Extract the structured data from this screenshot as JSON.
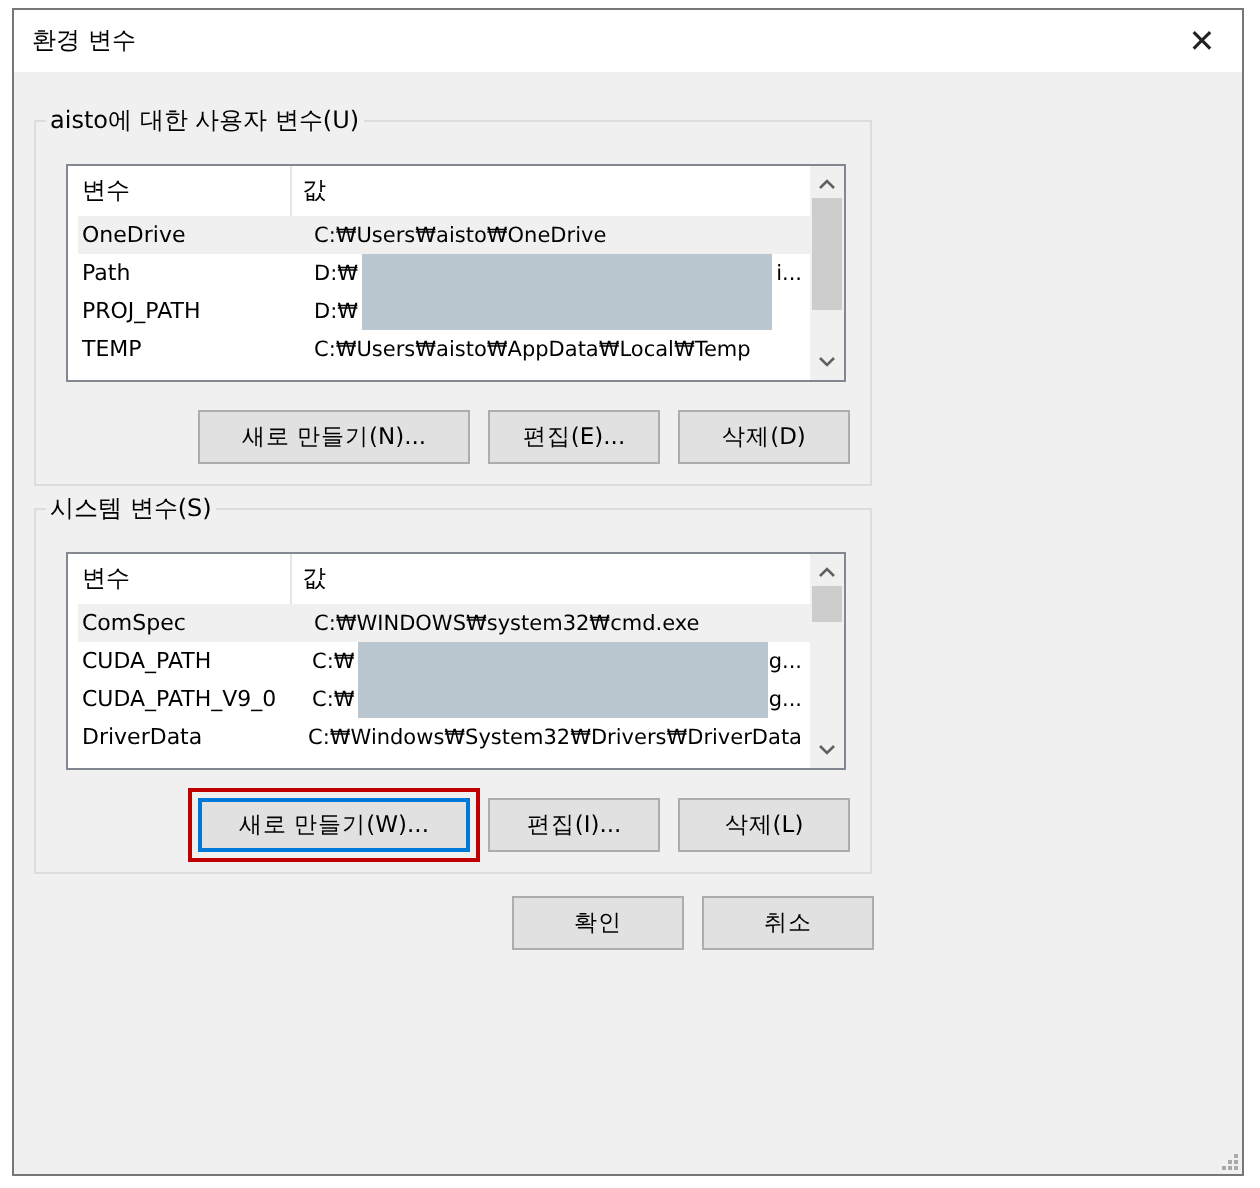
{
  "window": {
    "title": "환경 변수",
    "close": "✕"
  },
  "groups": [
    {
      "title": "aisto에 대한 사용자 변수(U)",
      "columns": [
        "변수",
        "값"
      ],
      "rows": [
        {
          "name": "OneDrive",
          "value": "C:₩Users₩aisto₩OneDrive",
          "selected": true
        },
        {
          "name": "Path",
          "value": "D:₩",
          "value_end": "i...",
          "redacted": true,
          "selected": false
        },
        {
          "name": "PROJ_PATH",
          "value": "D:₩",
          "redacted": true,
          "selected": false
        },
        {
          "name": "TEMP",
          "value": "C:₩Users₩aisto₩AppData₩Local₩Temp",
          "selected": false
        }
      ],
      "buttons": [
        {
          "label": "새로 만들기(N)...",
          "default": false,
          "highlighted": false
        },
        {
          "label": "편집(E)...",
          "default": false,
          "highlighted": false
        },
        {
          "label": "삭제(D)",
          "default": false,
          "highlighted": false
        }
      ]
    },
    {
      "title": "시스템 변수(S)",
      "columns": [
        "변수",
        "값"
      ],
      "rows": [
        {
          "name": "ComSpec",
          "value": "C:₩WINDOWS₩system32₩cmd.exe",
          "selected": true
        },
        {
          "name": "CUDA_PATH",
          "value": "C:₩",
          "value_end": "g...",
          "redacted": true,
          "selected": false
        },
        {
          "name": "CUDA_PATH_V9_0",
          "value": "C:₩",
          "value_end": "g...",
          "redacted": true,
          "selected": false
        },
        {
          "name": "DriverData",
          "value": "C:₩Windows₩System32₩Drivers₩DriverData",
          "selected": false
        }
      ],
      "buttons": [
        {
          "label": "새로 만들기(W)...",
          "default": true,
          "highlighted": true
        },
        {
          "label": "편집(I)...",
          "default": false,
          "highlighted": false
        },
        {
          "label": "삭제(L)",
          "default": false,
          "highlighted": false
        }
      ]
    }
  ],
  "footer_buttons": [
    {
      "label": "확인"
    },
    {
      "label": "취소"
    }
  ]
}
